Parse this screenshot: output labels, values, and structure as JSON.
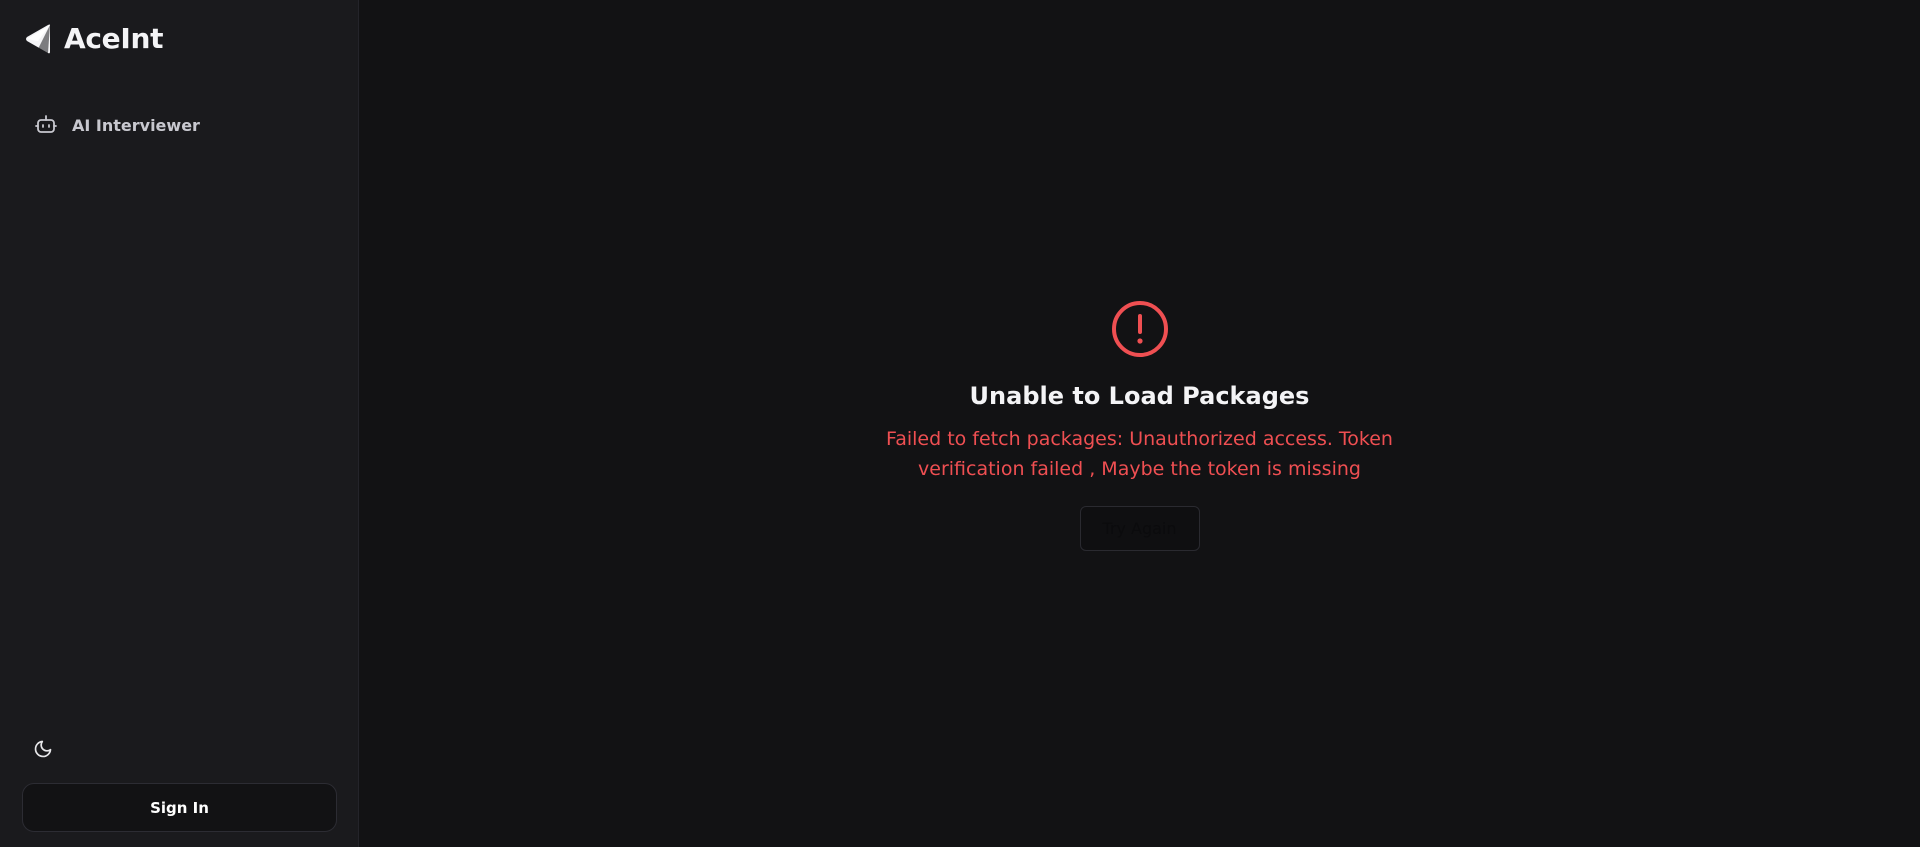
{
  "brand": {
    "name": "AceInt",
    "logo_icon": "paper-plane-logo-icon"
  },
  "sidebar": {
    "items": [
      {
        "label": "AI Interviewer",
        "icon": "bot-icon"
      }
    ],
    "theme_toggle_icon": "moon-icon",
    "signin_label": "Sign In"
  },
  "main": {
    "error": {
      "icon": "alert-circle-icon",
      "title": "Unable to Load Packages",
      "message": "Failed to fetch packages: Unauthorized access. Token verification failed , Maybe the token is missing",
      "retry_label": "Try Again"
    }
  },
  "colors": {
    "background": "#121214",
    "sidebar": "#1a1a1d",
    "error": "#ef4f52",
    "text_primary": "#f4f4f6"
  }
}
